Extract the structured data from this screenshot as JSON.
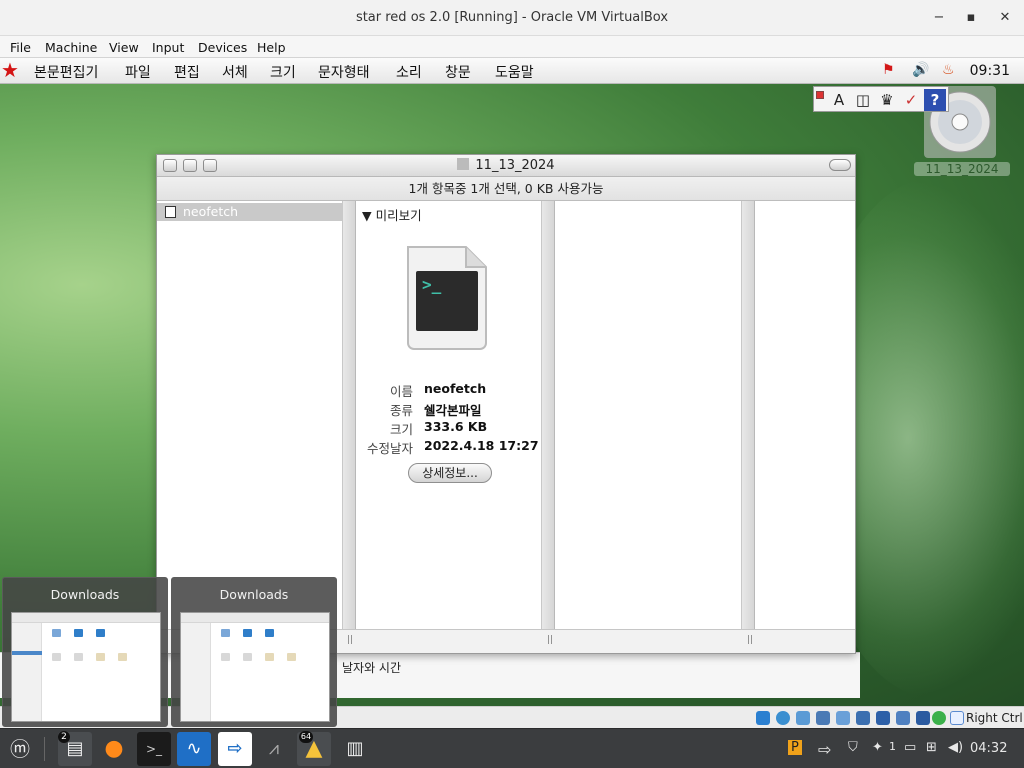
{
  "host": {
    "title": "star red os 2.0 [Running] - Oracle VM VirtualBox",
    "controls": {
      "minimize": "−",
      "maximize": "▪",
      "close": "✕"
    },
    "menu": [
      "File",
      "Machine",
      "View",
      "Input",
      "Devices",
      "Help"
    ],
    "status_right": "Right Ctrl"
  },
  "guest": {
    "menu": [
      "본문편집기",
      "파일",
      "편집",
      "서체",
      "크기",
      "문자형태",
      "소리",
      "창문",
      "도움말"
    ],
    "clock": "09:31",
    "palette": [
      "A",
      "◫",
      "♛",
      "✓",
      "?"
    ],
    "desktop_disk_label": "11_13_2024"
  },
  "finder": {
    "title": "11_13_2024",
    "status": "1개 항목중 1개 선택, 0 KB 사용가능",
    "selected_item": "neofetch",
    "preview_header": "미리보기",
    "file_prompt": ">_",
    "info": [
      {
        "key": "이름",
        "value": "neofetch"
      },
      {
        "key": "종류",
        "value": "쉘각본파일"
      },
      {
        "key": "크기",
        "value": "333.6 KB"
      },
      {
        "key": "수정날자",
        "value": "2022.4.18 17:27"
      }
    ],
    "more_button": "상세정보..."
  },
  "background_window": {
    "label": "날자와 시간"
  },
  "previews": [
    {
      "title": "Downloads"
    },
    {
      "title": "Downloads"
    }
  ],
  "taskbar": {
    "badge_files": "2",
    "badge_app": "64",
    "tray_count": "1",
    "clock": "04:32"
  }
}
